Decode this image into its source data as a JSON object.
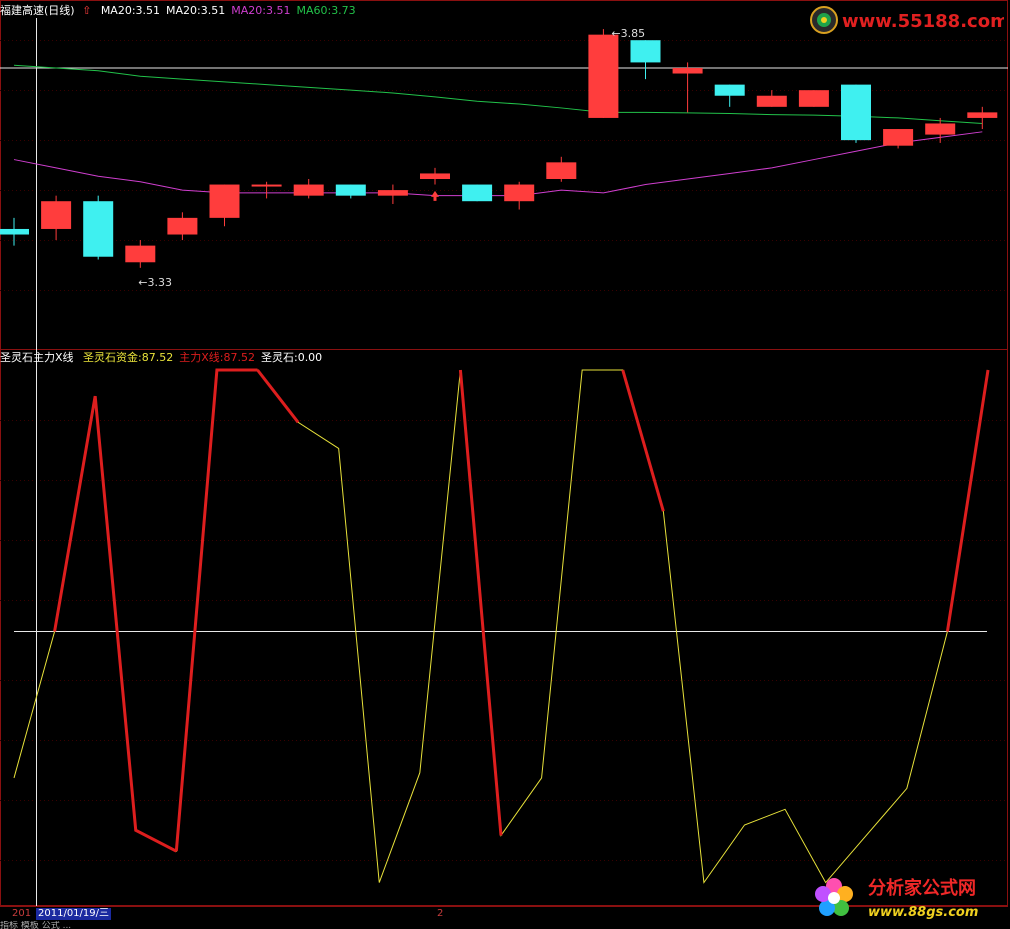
{
  "colors": {
    "background": "#000000",
    "up_candle": "#ff3d3d",
    "down_candle": "#3ff0f0",
    "ma20": "#cf3fcf",
    "ma60": "#22c24a",
    "hline": "#e8e8e8",
    "indicator_main": "#e8e23a",
    "indicator_red": "#dd1e1e",
    "grid": "#3a0000"
  },
  "price_panel": {
    "title": "福建高速(日线)",
    "legend": [
      {
        "text": "MA20:3.51",
        "color": "#ffffff"
      },
      {
        "text": "MA20:3.51",
        "color": "#ffffff"
      },
      {
        "text": "MA20:3.51",
        "color": "#cf3fcf"
      },
      {
        "text": "MA60:3.73",
        "color": "#22c24a"
      }
    ],
    "arrow_icon": "up-arrow-icon",
    "high_label": "3.85",
    "low_label": "3.33",
    "candles": [
      {
        "open": 3.5,
        "close": 3.49,
        "high": 3.52,
        "low": 3.47
      },
      {
        "open": 3.5,
        "close": 3.55,
        "high": 3.56,
        "low": 3.48
      },
      {
        "open": 3.55,
        "close": 3.45,
        "high": 3.56,
        "low": 3.445
      },
      {
        "open": 3.44,
        "close": 3.47,
        "high": 3.48,
        "low": 3.43
      },
      {
        "open": 3.49,
        "close": 3.52,
        "high": 3.53,
        "low": 3.48
      },
      {
        "open": 3.52,
        "close": 3.58,
        "high": 3.58,
        "low": 3.505
      },
      {
        "open": 3.58,
        "close": 3.58,
        "high": 3.585,
        "low": 3.555
      },
      {
        "open": 3.56,
        "close": 3.58,
        "high": 3.59,
        "low": 3.555
      },
      {
        "open": 3.58,
        "close": 3.56,
        "high": 3.58,
        "low": 3.555
      },
      {
        "open": 3.56,
        "close": 3.57,
        "high": 3.58,
        "low": 3.545
      },
      {
        "open": 3.59,
        "close": 3.6,
        "high": 3.61,
        "low": 3.58
      },
      {
        "open": 3.58,
        "close": 3.55,
        "high": 3.58,
        "low": 3.55
      },
      {
        "open": 3.55,
        "close": 3.58,
        "high": 3.585,
        "low": 3.535
      },
      {
        "open": 3.59,
        "close": 3.62,
        "high": 3.63,
        "low": 3.585
      },
      {
        "open": 3.7,
        "close": 3.85,
        "high": 3.86,
        "low": 3.7
      },
      {
        "open": 3.84,
        "close": 3.8,
        "high": 3.84,
        "low": 3.77
      },
      {
        "open": 3.78,
        "close": 3.79,
        "high": 3.8,
        "low": 3.71
      },
      {
        "open": 3.76,
        "close": 3.74,
        "high": 3.76,
        "low": 3.72
      },
      {
        "open": 3.72,
        "close": 3.74,
        "high": 3.75,
        "low": 3.72
      },
      {
        "open": 3.72,
        "close": 3.75,
        "high": 3.75,
        "low": 3.72
      },
      {
        "open": 3.76,
        "close": 3.66,
        "high": 3.76,
        "low": 3.655
      },
      {
        "open": 3.65,
        "close": 3.68,
        "high": 3.68,
        "low": 3.645
      },
      {
        "open": 3.67,
        "close": 3.69,
        "high": 3.7,
        "low": 3.655
      },
      {
        "open": 3.7,
        "close": 3.71,
        "high": 3.72,
        "low": 3.68
      }
    ],
    "ma20_points": [
      3.625,
      3.61,
      3.595,
      3.585,
      3.57,
      3.565,
      3.565,
      3.565,
      3.565,
      3.565,
      3.56,
      3.56,
      3.56,
      3.57,
      3.565,
      3.58,
      3.59,
      3.6,
      3.61,
      3.625,
      3.64,
      3.655,
      3.665,
      3.675
    ],
    "ma60_points": [
      3.795,
      3.79,
      3.785,
      3.775,
      3.77,
      3.765,
      3.76,
      3.755,
      3.75,
      3.745,
      3.738,
      3.73,
      3.725,
      3.718,
      3.71,
      3.71,
      3.709,
      3.708,
      3.706,
      3.705,
      3.703,
      3.7,
      3.695,
      3.69
    ],
    "hline_value": 3.79
  },
  "indicator_panel": {
    "name": "圣灵石主力X线",
    "legend": [
      {
        "text": "圣灵石资金:87.52",
        "color": "#e8e23a"
      },
      {
        "text": "主力X线:87.52",
        "color": "#dd1e1e"
      },
      {
        "text": "圣灵石:0.00",
        "color": "#ffffff"
      }
    ],
    "series": [
      22,
      50,
      95,
      12,
      8,
      100,
      100,
      90,
      85,
      2,
      23,
      100,
      11,
      22,
      100,
      100,
      73,
      2,
      13,
      16,
      2,
      11,
      20,
      50,
      100
    ],
    "red_segments": [
      [
        1,
        4
      ],
      [
        4,
        6
      ],
      [
        6,
        7
      ],
      [
        11,
        12
      ],
      [
        15,
        16
      ],
      [
        23,
        24
      ]
    ],
    "hline_value": 50
  },
  "footer": {
    "left_label": "201",
    "date": "2011/01/19/三",
    "mid_label": "2",
    "status": "指标  模板  公式  ..."
  },
  "watermarks": {
    "top_text": "www.55188.com",
    "bottom_title": "分析家公式网",
    "bottom_url": "www.88gs.com"
  }
}
